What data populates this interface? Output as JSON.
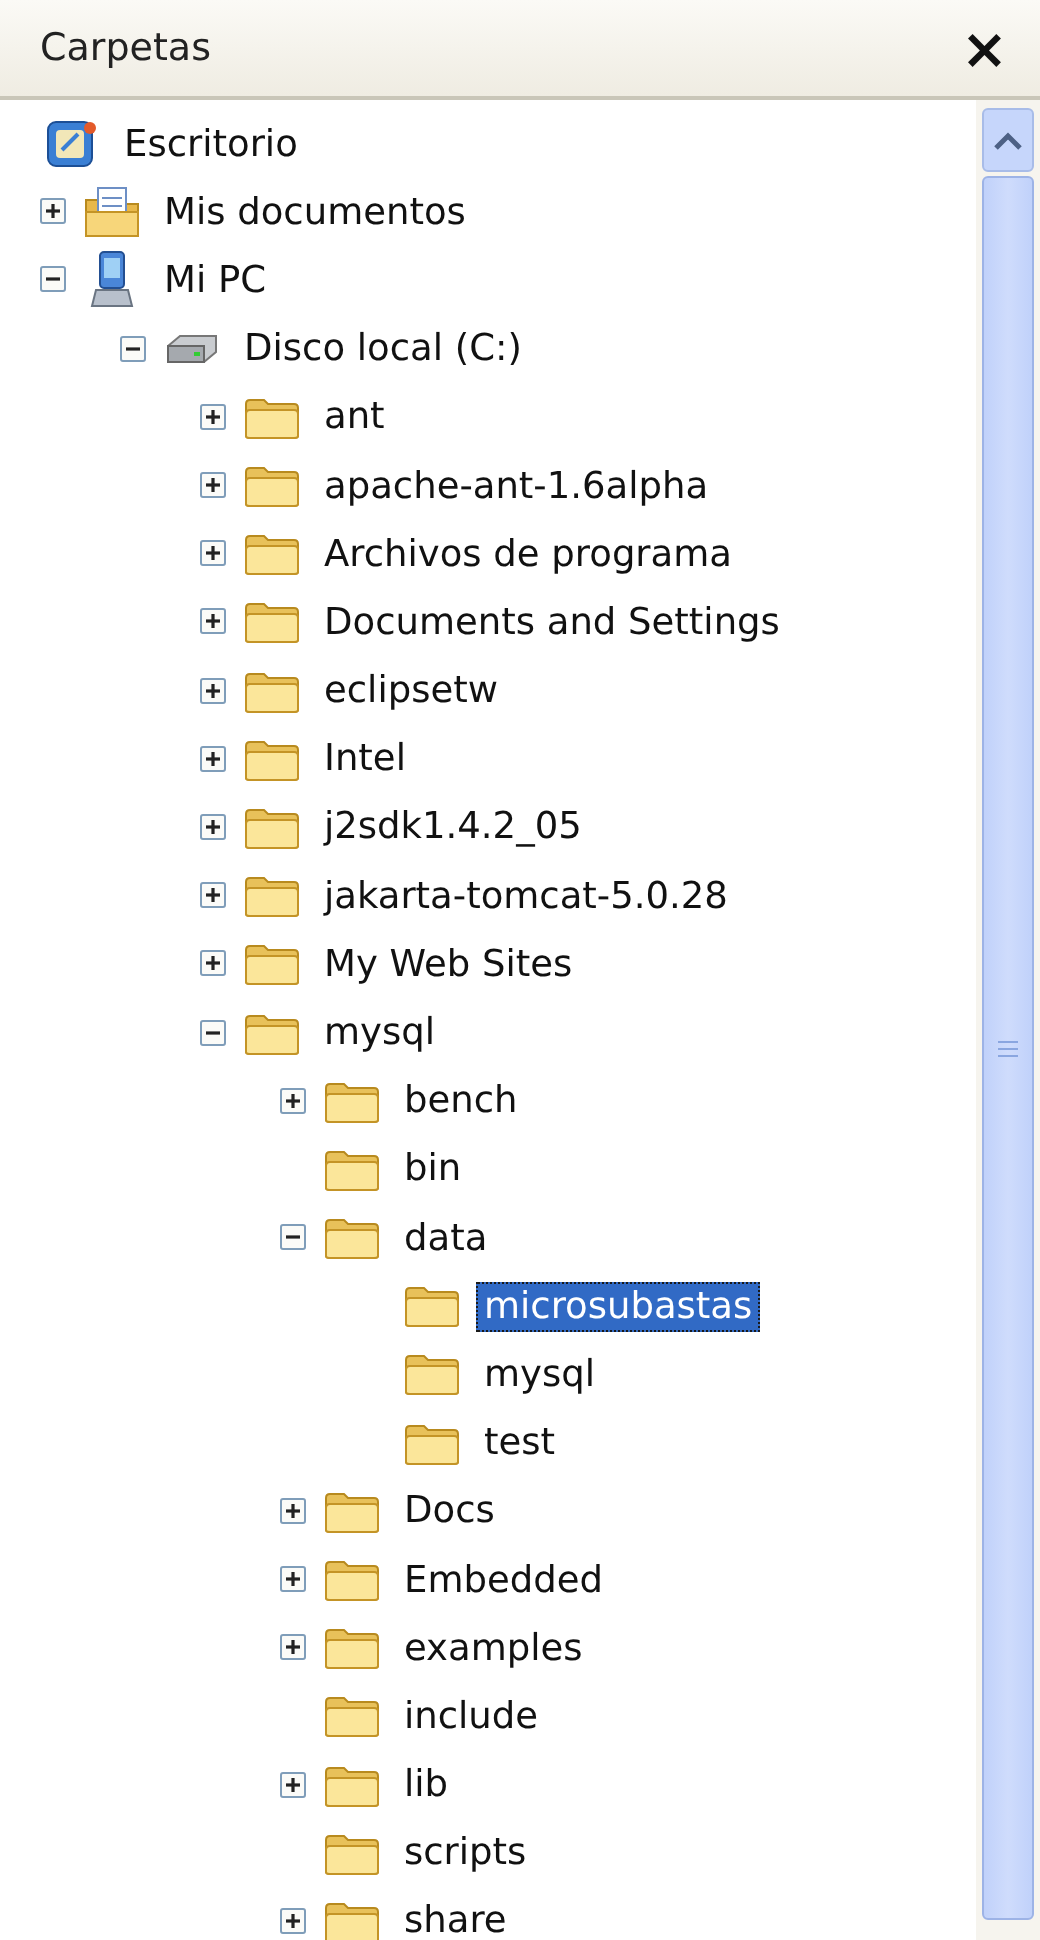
{
  "panel": {
    "title": "Carpetas",
    "close": "×"
  },
  "tree": [
    {
      "label": "Escritorio",
      "kind": "desktop",
      "selected": false,
      "children": [
        {
          "label": "Mis documentos",
          "kind": "documents",
          "selected": false,
          "expanded": false
        },
        {
          "label": "Mi PC",
          "kind": "computer",
          "selected": false,
          "expanded": true,
          "children": [
            {
              "label": "Disco local (C:)",
              "kind": "drive",
              "selected": false,
              "expanded": true,
              "children": [
                {
                  "label": "ant",
                  "kind": "folder",
                  "selected": false,
                  "expanded": false
                },
                {
                  "label": "apache-ant-1.6alpha",
                  "kind": "folder",
                  "selected": false,
                  "expanded": false
                },
                {
                  "label": "Archivos de programa",
                  "kind": "folder",
                  "selected": false,
                  "expanded": false
                },
                {
                  "label": "Documents and Settings",
                  "kind": "folder",
                  "selected": false,
                  "expanded": false
                },
                {
                  "label": "eclipsetw",
                  "kind": "folder",
                  "selected": false,
                  "expanded": false
                },
                {
                  "label": "Intel",
                  "kind": "folder",
                  "selected": false,
                  "expanded": false
                },
                {
                  "label": "j2sdk1.4.2_05",
                  "kind": "folder",
                  "selected": false,
                  "expanded": false
                },
                {
                  "label": "jakarta-tomcat-5.0.28",
                  "kind": "folder",
                  "selected": false,
                  "expanded": false
                },
                {
                  "label": "My Web Sites",
                  "kind": "folder",
                  "selected": false,
                  "expanded": false
                },
                {
                  "label": "mysql",
                  "kind": "folder",
                  "selected": false,
                  "expanded": true,
                  "children": [
                    {
                      "label": "bench",
                      "kind": "folder",
                      "selected": false,
                      "expanded": false
                    },
                    {
                      "label": "bin",
                      "kind": "folder",
                      "selected": false
                    },
                    {
                      "label": "data",
                      "kind": "folder",
                      "selected": false,
                      "expanded": true,
                      "children": [
                        {
                          "label": "microsubastas",
                          "kind": "folder",
                          "selected": true
                        },
                        {
                          "label": "mysql",
                          "kind": "folder",
                          "selected": false
                        },
                        {
                          "label": "test",
                          "kind": "folder",
                          "selected": false
                        }
                      ]
                    },
                    {
                      "label": "Docs",
                      "kind": "folder",
                      "selected": false,
                      "expanded": false
                    },
                    {
                      "label": "Embedded",
                      "kind": "folder",
                      "selected": false,
                      "expanded": false
                    },
                    {
                      "label": "examples",
                      "kind": "folder",
                      "selected": false,
                      "expanded": false
                    },
                    {
                      "label": "include",
                      "kind": "folder",
                      "selected": false
                    },
                    {
                      "label": "lib",
                      "kind": "folder",
                      "selected": false,
                      "expanded": false
                    },
                    {
                      "label": "scripts",
                      "kind": "folder",
                      "selected": false
                    },
                    {
                      "label": "share",
                      "kind": "folder",
                      "selected": false,
                      "expanded": false
                    }
                  ]
                }
              ]
            }
          ]
        }
      ]
    }
  ]
}
